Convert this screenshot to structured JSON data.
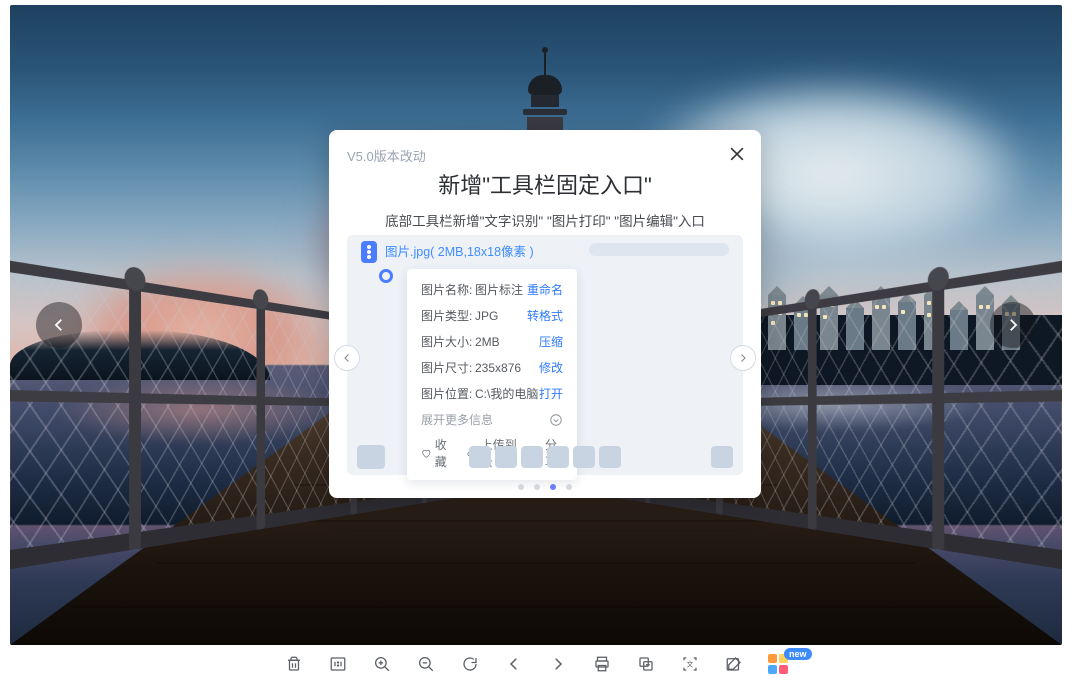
{
  "modal": {
    "version_note": "V5.0版本改动",
    "title": "新增\"工具栏固定入口\"",
    "subtitle": "底部工具栏新增\"文字识别\" \"图片打印\" \"图片编辑\"入口",
    "filename": "图片.jpg( 2MB,18x18像素 )"
  },
  "info": {
    "name_k": "图片名称:",
    "name_v": "图片标注",
    "name_a": "重命名",
    "type_k": "图片类型:",
    "type_v": "JPG",
    "type_a": "转格式",
    "size_k": "图片大小:",
    "size_v": "2MB",
    "size_a": "压缩",
    "dim_k": "图片尺寸:",
    "dim_v": "235x876",
    "dim_a": "修改",
    "loc_k": "图片位置:",
    "loc_v": "C:\\我的电脑",
    "loc_a": "打开",
    "expand": "展开更多信息"
  },
  "actions": {
    "fav": "收藏",
    "cloud": "上传到云",
    "share": "分享"
  },
  "badge": "new",
  "toolbar_names": [
    "delete",
    "fit-1-1",
    "zoom-in",
    "zoom-out",
    "rotate",
    "prev",
    "next",
    "print",
    "ocr-copy",
    "ocr-detect",
    "edit",
    "apps"
  ]
}
